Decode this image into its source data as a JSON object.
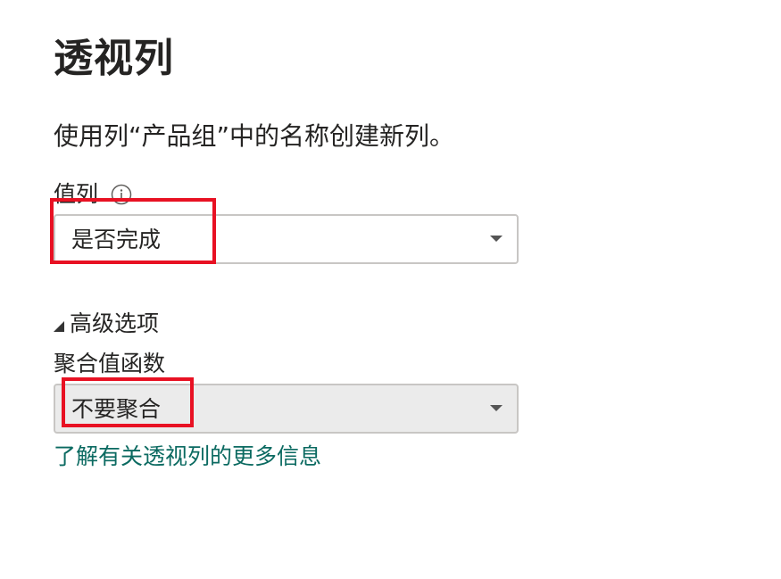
{
  "dialog": {
    "title": "透视列",
    "description": "使用列“产品组”中的名称创建新列。",
    "value_column": {
      "label": "值列",
      "info_icon": "info-icon",
      "selected": "是否完成"
    },
    "advanced": {
      "toggle_label": "高级选项",
      "expanded": true,
      "aggregate_label": "聚合值函数",
      "aggregate_selected": "不要聚合"
    },
    "learn_more_link": "了解有关透视列的更多信息"
  },
  "colors": {
    "annotation": "#e81123",
    "link": "#0b6a61",
    "text": "#252423",
    "disabled_dropdown_bg": "#ebebeb"
  }
}
